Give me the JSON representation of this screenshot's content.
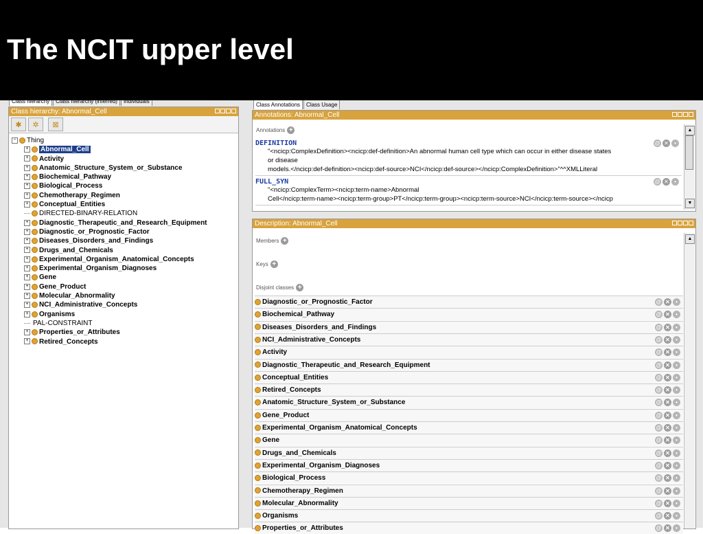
{
  "slide": {
    "title": "The NCIT upper level"
  },
  "left_tabs": [
    "Class hierarchy",
    "Class hierarchy (inferred)",
    "Individuals"
  ],
  "right_tabs": [
    "Class Annotations",
    "Class Usage"
  ],
  "hierarchy": {
    "header": "Class hierarchy: Abnormal_Cell",
    "root": "Thing",
    "items": [
      {
        "label": "Abnormal_Cell",
        "bold": true,
        "selected": true,
        "expandable": true,
        "class_icon": true
      },
      {
        "label": "Activity",
        "bold": true,
        "expandable": true,
        "class_icon": true
      },
      {
        "label": "Anatomic_Structure_System_or_Substance",
        "bold": true,
        "expandable": true,
        "class_icon": true
      },
      {
        "label": "Biochemical_Pathway",
        "bold": true,
        "expandable": true,
        "class_icon": true
      },
      {
        "label": "Biological_Process",
        "bold": true,
        "expandable": true,
        "class_icon": true
      },
      {
        "label": "Chemotherapy_Regimen",
        "bold": true,
        "expandable": true,
        "class_icon": true
      },
      {
        "label": "Conceptual_Entities",
        "bold": true,
        "expandable": true,
        "class_icon": true
      },
      {
        "label": "DIRECTED-BINARY-RELATION",
        "bold": false,
        "expandable": false,
        "class_icon": true
      },
      {
        "label": "Diagnostic_Therapeutic_and_Research_Equipment",
        "bold": true,
        "expandable": true,
        "class_icon": true
      },
      {
        "label": "Diagnostic_or_Prognostic_Factor",
        "bold": true,
        "expandable": true,
        "class_icon": true
      },
      {
        "label": "Diseases_Disorders_and_Findings",
        "bold": true,
        "expandable": true,
        "class_icon": true
      },
      {
        "label": "Drugs_and_Chemicals",
        "bold": true,
        "expandable": true,
        "class_icon": true
      },
      {
        "label": "Experimental_Organism_Anatomical_Concepts",
        "bold": true,
        "expandable": true,
        "class_icon": true
      },
      {
        "label": "Experimental_Organism_Diagnoses",
        "bold": true,
        "expandable": true,
        "class_icon": true
      },
      {
        "label": "Gene",
        "bold": true,
        "expandable": true,
        "class_icon": true
      },
      {
        "label": "Gene_Product",
        "bold": true,
        "expandable": true,
        "class_icon": true
      },
      {
        "label": "Molecular_Abnormality",
        "bold": true,
        "expandable": true,
        "class_icon": true
      },
      {
        "label": "NCI_Administrative_Concepts",
        "bold": true,
        "expandable": true,
        "class_icon": true
      },
      {
        "label": "Organisms",
        "bold": true,
        "expandable": true,
        "class_icon": true
      },
      {
        "label": "PAL-CONSTRAINT",
        "bold": false,
        "expandable": false,
        "class_icon": false
      },
      {
        "label": "Properties_or_Attributes",
        "bold": true,
        "expandable": true,
        "class_icon": true
      },
      {
        "label": "Retired_Concepts",
        "bold": true,
        "expandable": true,
        "class_icon": true
      }
    ]
  },
  "annotations": {
    "header": "Annotations: Abnormal_Cell",
    "section_label": "Annotations",
    "entries": [
      {
        "name": "DEFINITION",
        "lines": [
          "\"<ncicp:ComplexDefinition><ncicp:def-definition>An abnormal human cell type which can occur in either disease states",
          "or disease",
          "models.</ncicp:def-definition><ncicp:def-source>NCI</ncicp:def-source></ncicp:ComplexDefinition>\"^^XMLLiteral"
        ]
      },
      {
        "name": "FULL_SYN",
        "lines": [
          "\"<ncicp:ComplexTerm><ncicp:term-name>Abnormal",
          "Cell</ncicp:term-name><ncicp:term-group>PT</ncicp:term-group><ncicp:term-source>NCI</ncicp:term-source></ncicp"
        ]
      }
    ]
  },
  "description": {
    "header": "Description: Abnormal_Cell",
    "members_label": "Members",
    "keys_label": "Keys",
    "disjoint_label": "Disjoint classes",
    "disjoint_classes": [
      "Diagnostic_or_Prognostic_Factor",
      "Biochemical_Pathway",
      "Diseases_Disorders_and_Findings",
      "NCI_Administrative_Concepts",
      "Activity",
      "Diagnostic_Therapeutic_and_Research_Equipment",
      "Conceptual_Entities",
      "Retired_Concepts",
      "Anatomic_Structure_System_or_Substance",
      "Gene_Product",
      "Experimental_Organism_Anatomical_Concepts",
      "Gene",
      "Drugs_and_Chemicals",
      "Experimental_Organism_Diagnoses",
      "Biological_Process",
      "Chemotherapy_Regimen",
      "Molecular_Abnormality",
      "Organisms",
      "Properties_or_Attributes"
    ]
  },
  "colors": {
    "panel_header": "#d8a23c",
    "class_dot": "#e0a334",
    "selection": "#1e3f8a",
    "annotation_name": "#1a3aa0"
  }
}
